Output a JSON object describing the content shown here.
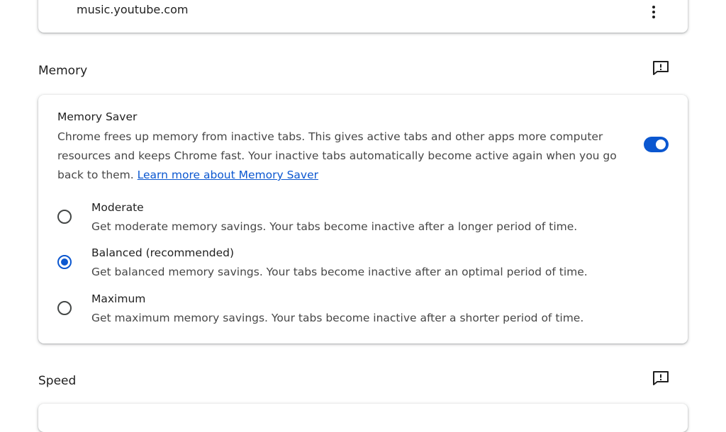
{
  "site_list": {
    "site": "music.youtube.com",
    "more_actions_icon": "more-vert-icon"
  },
  "memory": {
    "section_title": "Memory",
    "feedback_icon": "feedback-icon",
    "memory_saver": {
      "title": "Memory Saver",
      "description": "Chrome frees up memory from inactive tabs. This gives active tabs and other apps more computer resources and keeps Chrome fast. Your inactive tabs automatically become active again when you go back to them.",
      "learn_more_link": "Learn more about Memory Saver",
      "enabled": true
    },
    "options": [
      {
        "label": "Moderate",
        "description": "Get moderate memory savings. Your tabs become inactive after a longer period of time.",
        "selected": false
      },
      {
        "label": "Balanced (recommended)",
        "description": "Get balanced memory savings. Your tabs become inactive after an optimal period of time.",
        "selected": true
      },
      {
        "label": "Maximum",
        "description": "Get maximum memory savings. Your tabs become inactive after a shorter period of time.",
        "selected": false
      }
    ]
  },
  "speed": {
    "section_title": "Speed",
    "feedback_icon": "feedback-icon"
  },
  "colors": {
    "accent": "#0b57d0",
    "text_primary": "#1f1f1f",
    "text_secondary": "#474747"
  }
}
